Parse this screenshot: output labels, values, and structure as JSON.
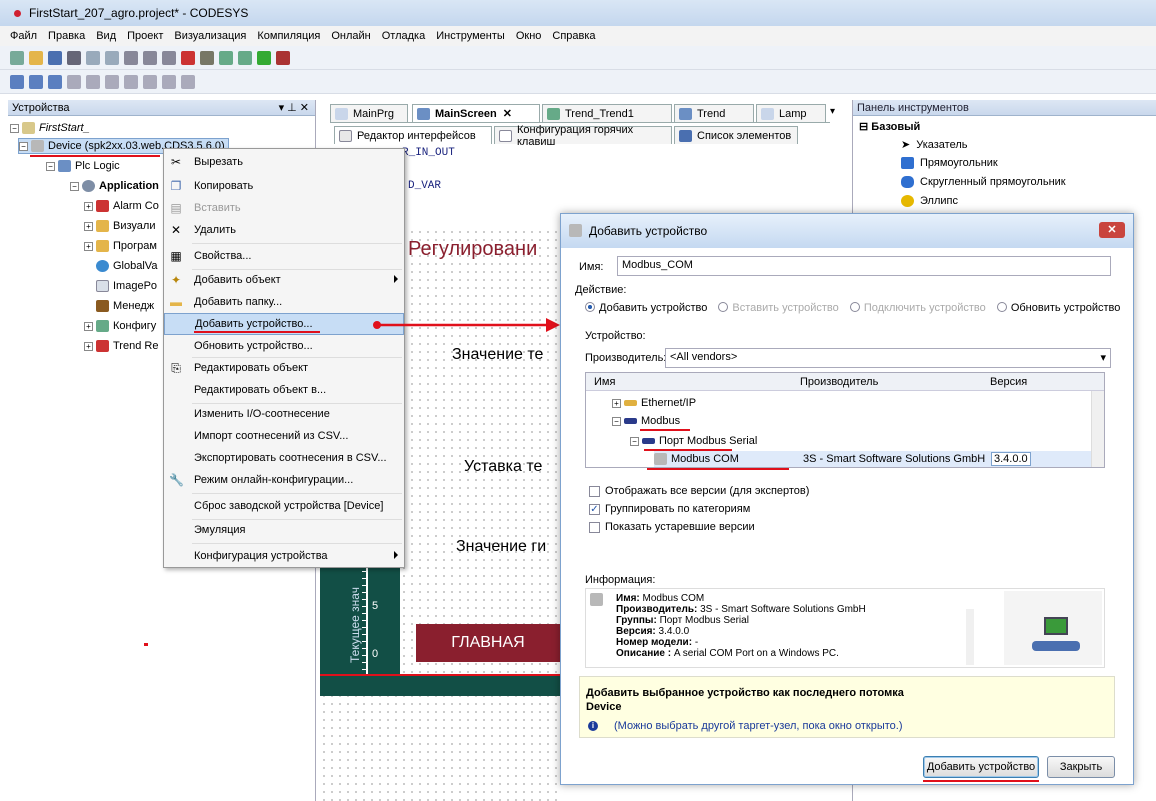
{
  "window": {
    "title": "FirstStart_207_agro.project* - CODESYS"
  },
  "menu": [
    "Файл",
    "Правка",
    "Вид",
    "Проект",
    "Визуализация",
    "Компиляция",
    "Онлайн",
    "Отладка",
    "Инструменты",
    "Окно",
    "Справка"
  ],
  "devices_panel": {
    "title": "Устройства",
    "tree": {
      "root": "FirstStart_",
      "device": "Device (spk2xx.03.web.CDS3.5.6.0)",
      "plc": "Plc Logic",
      "application": "Application",
      "items": [
        "Alarm Co",
        "Визуали",
        "Програм",
        "GlobalVa",
        "ImagePo",
        "Менедж",
        "Конфигу",
        "Trend Re"
      ]
    }
  },
  "editor": {
    "tabs": [
      "MainPrg",
      "MainScreen",
      "Trend_Trend1",
      "Trend",
      "Lamp"
    ],
    "subtabs": [
      "Редактор интерфейсов",
      "Конфигурация горячих клавиш",
      "Список элементов"
    ],
    "code": [
      "R_IN_OUT",
      "D_VAR"
    ],
    "canvas": {
      "heading": "Регулировани",
      "labels": [
        "Значение те",
        "Уставка те",
        "Значение ги"
      ],
      "bar_label": "Текущее знач",
      "scale": [
        "5",
        "0"
      ],
      "button": "ГЛАВНАЯ"
    }
  },
  "toolbox": {
    "title": "Панель инструментов",
    "group": "Базовый",
    "items": [
      "Указатель",
      "Прямоугольник",
      "Скругленный прямоугольник",
      "Эллипс"
    ]
  },
  "context_menu": [
    {
      "label": "Вырезать",
      "icon": "scissors-icon",
      "enabled": true
    },
    {
      "label": "Копировать",
      "icon": "copy-icon",
      "enabled": true
    },
    {
      "label": "Вставить",
      "icon": "paste-icon",
      "enabled": false
    },
    {
      "label": "Удалить",
      "icon": "delete-icon",
      "enabled": true
    },
    {
      "label": "Свойства...",
      "icon": "properties-icon",
      "enabled": true
    },
    {
      "label": "Добавить объект",
      "icon": "add-object-icon",
      "enabled": true,
      "submenu": true
    },
    {
      "label": "Добавить папку...",
      "icon": "folder-icon",
      "enabled": true
    },
    {
      "label": "Добавить устройство...",
      "enabled": true,
      "highlighted": true
    },
    {
      "label": "Обновить устройство...",
      "enabled": true
    },
    {
      "label": "Редактировать объект",
      "icon": "edit-icon",
      "enabled": true
    },
    {
      "label": "Редактировать объект в...",
      "enabled": true
    },
    {
      "label": "Изменить I/O-соотнесение",
      "enabled": true
    },
    {
      "label": "Импорт соотнесений из CSV...",
      "enabled": true
    },
    {
      "label": "Экспортировать соотнесения в CSV...",
      "enabled": true
    },
    {
      "label": "Режим онлайн-конфигурации...",
      "icon": "wrench-icon",
      "enabled": true
    },
    {
      "label": "Сброс заводской устройства [Device]",
      "enabled": true
    },
    {
      "label": "Эмуляция",
      "enabled": true
    },
    {
      "label": "Конфигурация устройства",
      "enabled": true,
      "submenu": true
    }
  ],
  "dialog": {
    "title": "Добавить устройство",
    "name_label": "Имя:",
    "name_value": "Modbus_COM",
    "action_label": "Действие:",
    "actions": [
      "Добавить устройство",
      "Вставить устройство",
      "Подключить устройство",
      "Обновить устройство"
    ],
    "device_label": "Устройство:",
    "vendor_label": "Производитель:",
    "vendor_value": "<All vendors>",
    "columns": [
      "Имя",
      "Производитель",
      "Версия"
    ],
    "tree": [
      {
        "name": "Ethernet/IP"
      },
      {
        "name": "Modbus"
      },
      {
        "name": "Порт Modbus Serial"
      },
      {
        "name": "Modbus COM",
        "vendor": "3S - Smart Software Solutions GmbH",
        "version": "3.4.0.0"
      }
    ],
    "checks": [
      {
        "label": "Отображать все версии (для экспертов)",
        "checked": false
      },
      {
        "label": "Группировать по категориям",
        "checked": true
      },
      {
        "label": "Показать устаревшие версии",
        "checked": false
      }
    ],
    "info_label": "Информация:",
    "info": {
      "name_k": "Имя:",
      "name_v": "Modbus COM",
      "vendor_k": "Производитель:",
      "vendor_v": "3S - Smart Software Solutions GmbH",
      "groups_k": "Группы:",
      "groups_v": "Порт Modbus Serial",
      "version_k": "Версия:",
      "version_v": "3.4.0.0",
      "model_k": "Номер модели:",
      "model_v": "-",
      "desc_k": "Описание :",
      "desc_v": "A serial COM Port on a Windows PC."
    },
    "hint_line1": "Добавить выбранное устройство как последнего потомка",
    "hint_line2": "Device",
    "hint_note": "(Можно выбрать другой таргет-узел, пока окно открыто.)",
    "add_button": "Добавить устройство",
    "close_button": "Закрыть"
  },
  "colors": {
    "accent": "#e0101b",
    "highlight": "#c7ddf5",
    "canvas_dark": "#124f46",
    "maroon": "#8a1f2e"
  }
}
